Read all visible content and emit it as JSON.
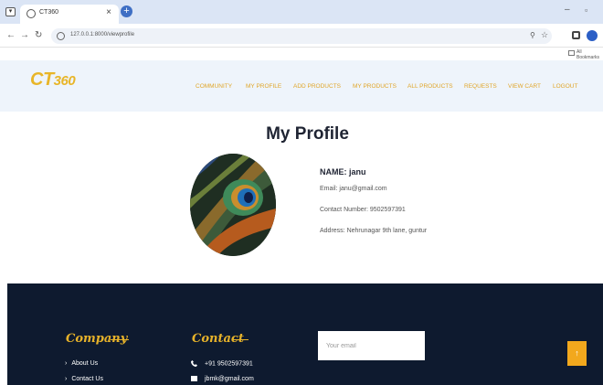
{
  "browser": {
    "tab_title": "CT360",
    "url": "127.0.0.1:8000/viewprofile",
    "bookmarks_label": "All Bookmarks",
    "new_tab_glyph": "+",
    "close_glyph": "×"
  },
  "site": {
    "logo_main": "CT",
    "logo_suffix": "360",
    "accent_color": "#e8b528",
    "nav": [
      {
        "label": "COMMUNITY"
      },
      {
        "label": "MY PROFILE"
      },
      {
        "label": "ADD PRODUCTS"
      },
      {
        "label": "MY PRODUCTS"
      },
      {
        "label": "ALL PRODUCTS"
      },
      {
        "label": "REQUESTS"
      },
      {
        "label": "VIEW CART"
      },
      {
        "label": "LOGOUT"
      }
    ]
  },
  "profile": {
    "title": "My Profile",
    "name_line": "NAME: janu",
    "email_line": "Email: janu@gmail.com",
    "contact_line": "Contact Number: 9502597391",
    "address_line": "Address: Nehrunagar 9th lane, guntur"
  },
  "footer": {
    "company_heading": "Company",
    "company_links": [
      {
        "label": "About Us"
      },
      {
        "label": "Contact Us"
      }
    ],
    "contact_heading": "Contact",
    "phone": "+91 9502597391",
    "email": "jbmk@gmail.com",
    "email_placeholder": "Your email",
    "back_to_top_glyph": "↑",
    "background_color": "#0e1a2f"
  }
}
